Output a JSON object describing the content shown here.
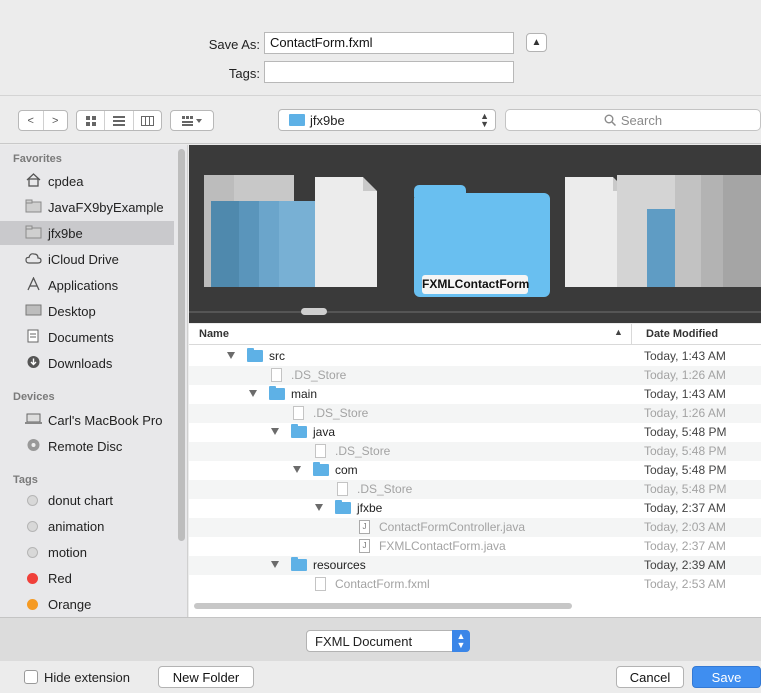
{
  "save_as": {
    "label": "Save As:",
    "value": "ContactForm.fxml"
  },
  "tags": {
    "label": "Tags:",
    "value": ""
  },
  "toolbar": {
    "back_glyph": "<",
    "forward_glyph": ">",
    "location": "jfx9be",
    "search_placeholder": "Search"
  },
  "sidebar": {
    "favorites_head": "Favorites",
    "favorites": [
      {
        "label": "cpdea",
        "icon": "home-icon"
      },
      {
        "label": "JavaFX9byExample",
        "icon": "folder-icon"
      },
      {
        "label": "jfx9be",
        "icon": "folder-icon",
        "selected": true
      },
      {
        "label": "iCloud Drive",
        "icon": "cloud-icon"
      },
      {
        "label": "Applications",
        "icon": "applications-icon"
      },
      {
        "label": "Desktop",
        "icon": "desktop-icon"
      },
      {
        "label": "Documents",
        "icon": "documents-icon"
      },
      {
        "label": "Downloads",
        "icon": "downloads-icon"
      }
    ],
    "devices_head": "Devices",
    "devices": [
      {
        "label": "Carl's MacBook Pro",
        "icon": "laptop-icon"
      },
      {
        "label": "Remote Disc",
        "icon": "disc-icon"
      }
    ],
    "tags_head": "Tags",
    "tags": [
      {
        "label": "donut chart",
        "color": "#d8d8d8"
      },
      {
        "label": "animation",
        "color": "#d8d8d8"
      },
      {
        "label": "motion",
        "color": "#d8d8d8"
      },
      {
        "label": "Red",
        "color": "#f0403a"
      },
      {
        "label": "Orange",
        "color": "#f59a23"
      }
    ]
  },
  "coverflow": {
    "caption": "FXMLContactForm"
  },
  "list": {
    "col_name": "Name",
    "col_date": "Date Modified",
    "rows": [
      {
        "name": "src",
        "date": "Today, 1:43 AM",
        "kind": "folder",
        "depth": 0,
        "open": true,
        "dim": false
      },
      {
        "name": ".DS_Store",
        "date": "Today, 1:26 AM",
        "kind": "doc",
        "depth": 1,
        "dim": true
      },
      {
        "name": "main",
        "date": "Today, 1:43 AM",
        "kind": "folder",
        "depth": 1,
        "open": true,
        "dim": false
      },
      {
        "name": ".DS_Store",
        "date": "Today, 1:26 AM",
        "kind": "doc",
        "depth": 2,
        "dim": true
      },
      {
        "name": "java",
        "date": "Today, 5:48 PM",
        "kind": "folder",
        "depth": 2,
        "open": true,
        "dim": false
      },
      {
        "name": ".DS_Store",
        "date": "Today, 5:48 PM",
        "kind": "doc",
        "depth": 3,
        "dim": true
      },
      {
        "name": "com",
        "date": "Today, 5:48 PM",
        "kind": "folder",
        "depth": 3,
        "open": true,
        "dim": false
      },
      {
        "name": ".DS_Store",
        "date": "Today, 5:48 PM",
        "kind": "doc",
        "depth": 4,
        "dim": true
      },
      {
        "name": "jfxbe",
        "date": "Today, 2:37 AM",
        "kind": "folder",
        "depth": 4,
        "open": true,
        "dim": false
      },
      {
        "name": "ContactFormController.java",
        "date": "Today, 2:03 AM",
        "kind": "java",
        "depth": 5,
        "dim": true
      },
      {
        "name": "FXMLContactForm.java",
        "date": "Today, 2:37 AM",
        "kind": "java",
        "depth": 5,
        "dim": true
      },
      {
        "name": "resources",
        "date": "Today, 2:39 AM",
        "kind": "folder",
        "depth": 2,
        "open": true,
        "dim": false
      },
      {
        "name": "ContactForm.fxml",
        "date": "Today, 2:53 AM",
        "kind": "doc",
        "depth": 3,
        "dim": true
      }
    ]
  },
  "format": {
    "value": "FXML Document"
  },
  "buttons": {
    "hide_extension": "Hide extension",
    "new_folder": "New Folder",
    "cancel": "Cancel",
    "save": "Save"
  }
}
